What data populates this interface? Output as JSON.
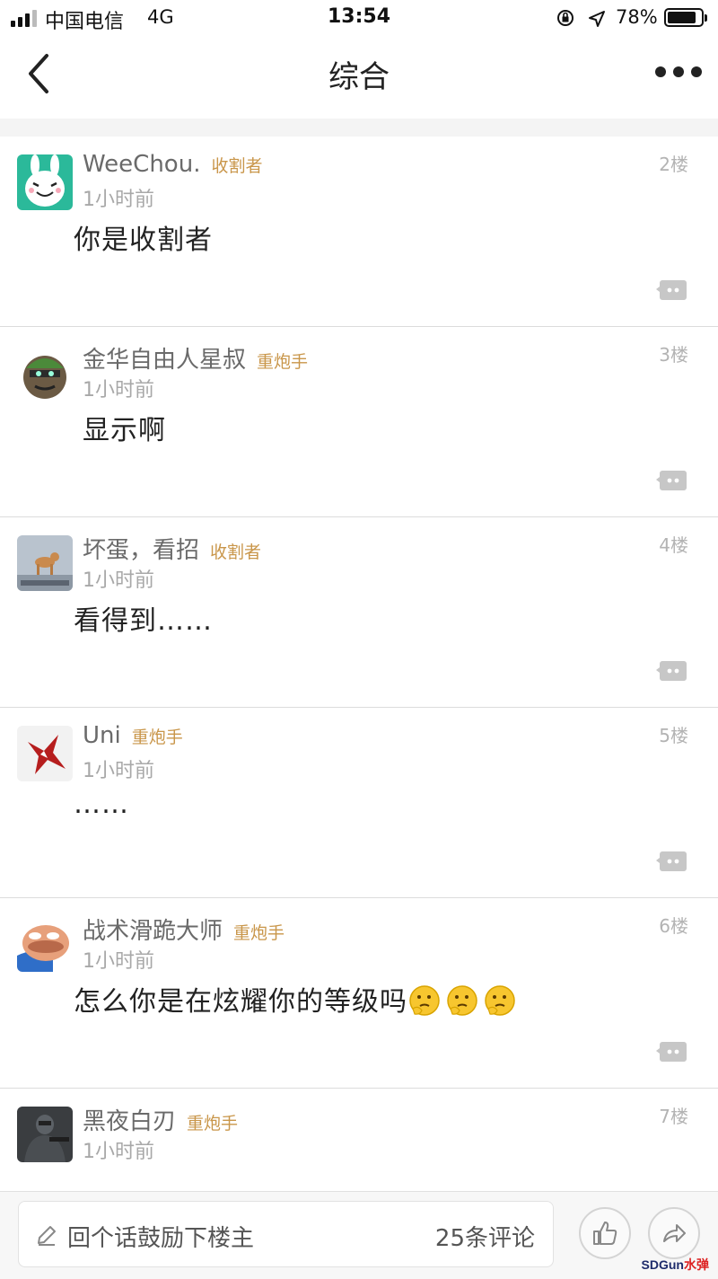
{
  "status_bar": {
    "carrier": "中国电信",
    "network": "4G",
    "time": "13:54",
    "battery_percent": "78%"
  },
  "nav": {
    "title": "综合"
  },
  "posts": [
    {
      "author": "WeeChou.",
      "badge": "收割者",
      "time": "1小时前",
      "floor": "2楼",
      "content": "你是收割者",
      "emoji_count": 0
    },
    {
      "author": "金华自由人星叔",
      "badge": "重炮手",
      "time": "1小时前",
      "floor": "3楼",
      "content": "显示啊",
      "emoji_count": 0
    },
    {
      "author": "坏蛋，看招",
      "badge": "收割者",
      "time": "1小时前",
      "floor": "4楼",
      "content": "看得到……",
      "emoji_count": 0
    },
    {
      "author": "Uni",
      "badge": "重炮手",
      "time": "1小时前",
      "floor": "5楼",
      "content": "……",
      "emoji_count": 0
    },
    {
      "author": "战术滑跪大师",
      "badge": "重炮手",
      "time": "1小时前",
      "floor": "6楼",
      "content": "怎么你是在炫耀你的等级吗",
      "emoji_count": 3
    },
    {
      "author": "黑夜白刃",
      "badge": "重炮手",
      "time": "1小时前",
      "floor": "7楼",
      "content": "",
      "emoji_count": 0
    }
  ],
  "bottom_bar": {
    "placeholder": "回个话鼓励下楼主",
    "comment_count": "25条评论"
  },
  "watermark": {
    "brand": "SDGun",
    "suffix": "水弹"
  },
  "colors": {
    "badge": "#c9964a",
    "background": "#f4f4f4"
  }
}
